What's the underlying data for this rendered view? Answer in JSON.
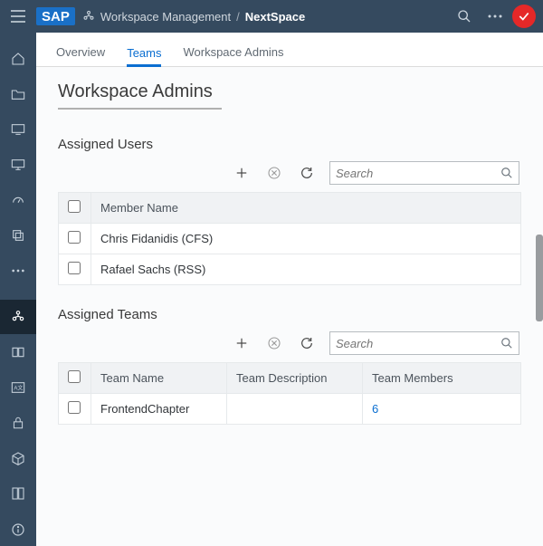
{
  "header": {
    "logo": "SAP",
    "breadcrumb_root": "Workspace Management",
    "breadcrumb_current": "NextSpace"
  },
  "tabs": {
    "overview": "Overview",
    "teams": "Teams",
    "admins": "Workspace Admins"
  },
  "page_title": "Workspace Admins",
  "users": {
    "section_title": "Assigned Users",
    "search_placeholder": "Search",
    "header_col": "Member Name",
    "rows": [
      {
        "name": "Chris Fidanidis (CFS)"
      },
      {
        "name": "Rafael Sachs (RSS)"
      }
    ]
  },
  "teams": {
    "section_title": "Assigned Teams",
    "search_placeholder": "Search",
    "header_name": "Team Name",
    "header_desc": "Team Description",
    "header_members": "Team Members",
    "rows": [
      {
        "name": "FrontendChapter",
        "desc": "",
        "members": "6"
      }
    ]
  }
}
